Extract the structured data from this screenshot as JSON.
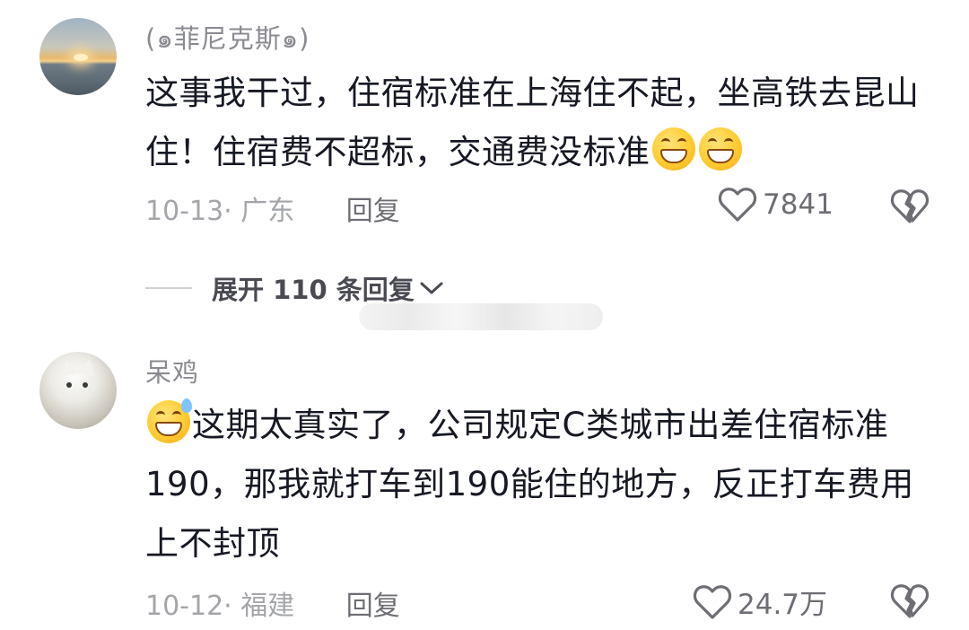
{
  "comments": [
    {
      "username": "(๑菲尼克斯๑)",
      "text_part1": "这事我干过，住宿标准在上海住不起，坐高铁去昆山住！住宿费不超标，交通费没标准",
      "emoji_trailing": [
        "grinning-face",
        "grinning-face"
      ],
      "date_region": "10-13· 广东",
      "reply_label": "回复",
      "likes": "7841"
    },
    {
      "username": "呆鸡",
      "emoji_leading": "grinning-face-with-sweat",
      "text": "这期太真实了，公司规定C类城市出差住宿标准190，那我就打车到190能住的地方，反正打车费用上不封顶",
      "date_region": "10-12· 福建",
      "reply_label": "回复",
      "likes": "24.7万"
    }
  ],
  "expand_replies": {
    "label": "展开 110 条回复"
  },
  "icons": {
    "like": "heart-outline-icon",
    "dislike": "broken-heart-icon",
    "expand": "chevron-down-icon"
  },
  "colors": {
    "text": "#161823",
    "meta": "#a4a5aa",
    "username": "#8a8b91"
  }
}
